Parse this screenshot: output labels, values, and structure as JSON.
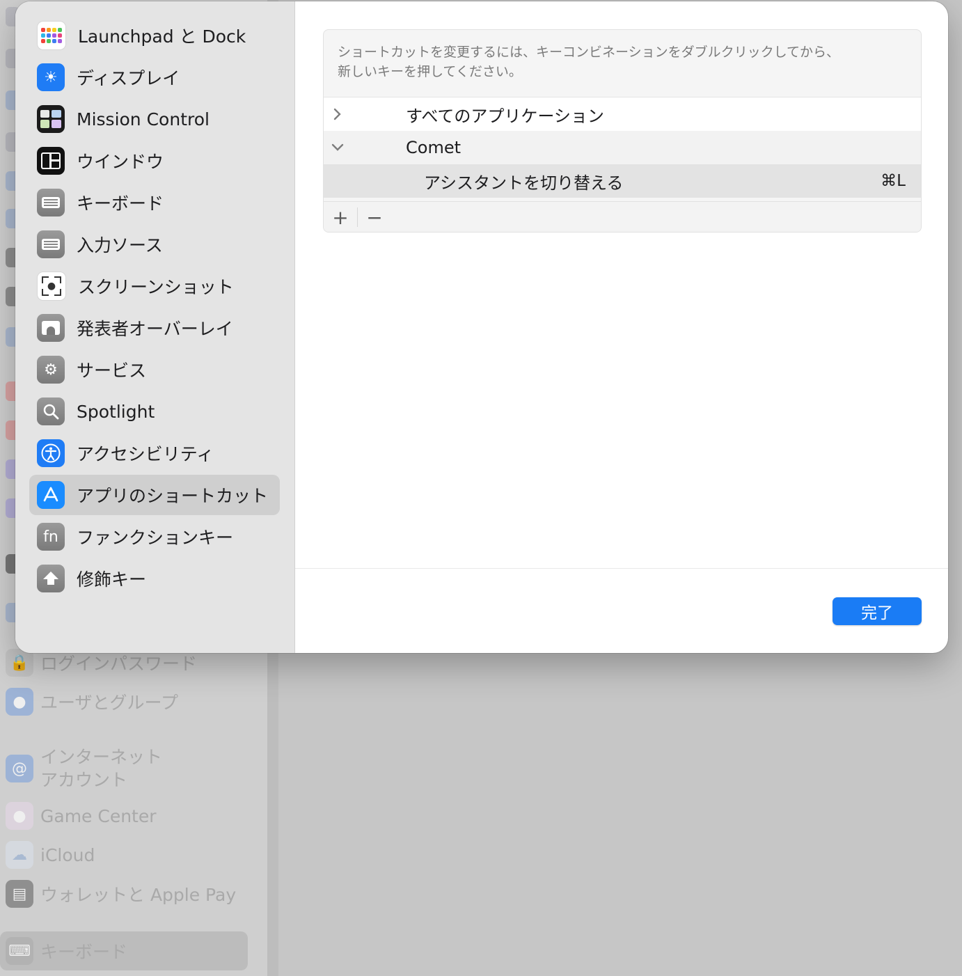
{
  "background": {
    "items": [
      {
        "label": "ログインパスワード",
        "icon": "lock-icon"
      },
      {
        "label": "ユーザとグループ",
        "icon": "users-icon"
      },
      {
        "label": "インターネット\nアカウント",
        "icon": "at-icon"
      },
      {
        "label": "Game Center",
        "icon": "game-center-icon"
      },
      {
        "label": "iCloud",
        "icon": "cloud-icon"
      },
      {
        "label": "ウォレットと Apple Pay",
        "icon": "wallet-icon"
      },
      {
        "label": "キーボード",
        "icon": "keyboard-icon"
      }
    ]
  },
  "sidebar": {
    "items": [
      {
        "label": "Launchpad と Dock",
        "icon": "launchpad-icon"
      },
      {
        "label": "ディスプレイ",
        "icon": "display-icon"
      },
      {
        "label": "Mission Control",
        "icon": "mission-control-icon"
      },
      {
        "label": "ウインドウ",
        "icon": "window-icon"
      },
      {
        "label": "キーボード",
        "icon": "keyboard-icon"
      },
      {
        "label": "入力ソース",
        "icon": "input-source-icon"
      },
      {
        "label": "スクリーンショット",
        "icon": "screenshot-icon"
      },
      {
        "label": "発表者オーバーレイ",
        "icon": "presenter-overlay-icon"
      },
      {
        "label": "サービス",
        "icon": "services-icon"
      },
      {
        "label": "Spotlight",
        "icon": "spotlight-icon"
      },
      {
        "label": "アクセシビリティ",
        "icon": "accessibility-icon"
      },
      {
        "label": "アプリのショートカット",
        "icon": "app-shortcuts-icon",
        "selected": true
      },
      {
        "label": "ファンクションキー",
        "icon": "function-keys-icon"
      },
      {
        "label": "修飾キー",
        "icon": "modifier-keys-icon"
      }
    ]
  },
  "main": {
    "instructions_line1": "ショートカットを変更するには、キーコンビネーションをダブルクリックしてから、",
    "instructions_line2": "新しいキーを押してください。",
    "tree": {
      "all_apps": "すべてのアプリケーション",
      "app_name": "Comet",
      "shortcut_name": "アシスタントを切り替える",
      "shortcut_keys": "⌘L"
    },
    "add_label": "+",
    "remove_label": "−",
    "done_label": "完了"
  },
  "colors": {
    "accent": "#1a7cf5",
    "sidebar_bg": "#e4e4e4",
    "selected_row": "#cfcfcf"
  }
}
